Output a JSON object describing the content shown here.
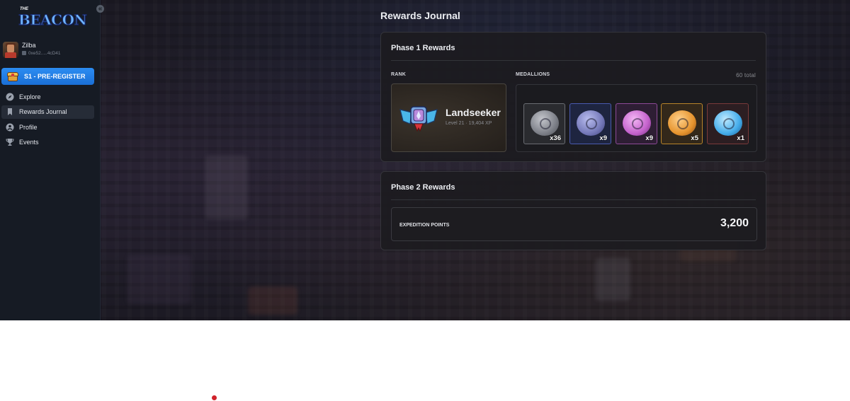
{
  "app": {
    "logo_small": "THE",
    "logo_word": "BEACON"
  },
  "user": {
    "name": "Zilba",
    "wallet": "0xe52.....4cD41"
  },
  "season": {
    "label": "S1 - PRE-REGISTER",
    "icon": "treasure-chest-icon"
  },
  "nav": {
    "items": [
      {
        "label": "Explore",
        "icon": "compass-icon",
        "active": false
      },
      {
        "label": "Rewards Journal",
        "icon": "bookmark-icon",
        "active": true
      },
      {
        "label": "Profile",
        "icon": "user-icon",
        "active": false
      },
      {
        "label": "Events",
        "icon": "trophy-icon",
        "active": false
      }
    ]
  },
  "main": {
    "title": "Rewards Journal",
    "phase1": {
      "title": "Phase 1 Rewards",
      "rank_label": "RANK",
      "rank_name": "Landseeker",
      "rank_sub": "Level 21 · 19,404 XP",
      "medallions_label": "MEDALLIONS",
      "medallions_total": "60 total",
      "medallions": [
        {
          "count": "x36",
          "tier": "grey",
          "color": "#8c8f96",
          "border": "#5f6268"
        },
        {
          "count": "x9",
          "tier": "blue",
          "color": "#7d83c4",
          "border": "#4a5aa8"
        },
        {
          "count": "x9",
          "tier": "purple",
          "color": "#d47ad8",
          "border": "#8e4a98"
        },
        {
          "count": "x5",
          "tier": "orange",
          "color": "#f0a03a",
          "border": "#b8842a"
        },
        {
          "count": "x1",
          "tier": "cyan",
          "color": "#4fb8f0",
          "border": "#7a3a3a"
        }
      ]
    },
    "phase2": {
      "title": "Phase 2 Rewards",
      "expedition_label": "EXPEDITION POINTS",
      "expedition_value": "3,200"
    }
  },
  "colors": {
    "accent": "#1e7be4",
    "sidebar_bg": "#161b24",
    "card_bg": "#1c1b1f"
  }
}
